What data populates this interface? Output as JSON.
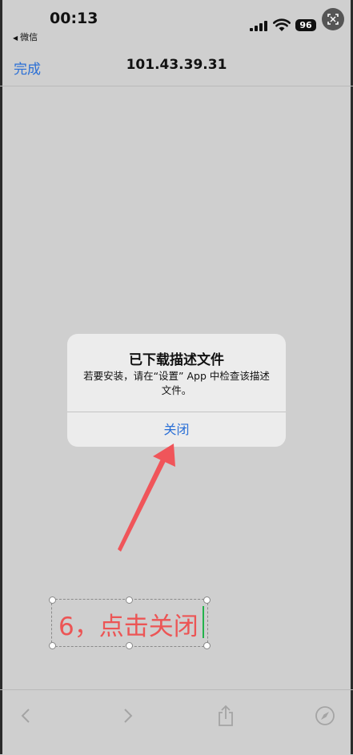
{
  "status_bar": {
    "time": "00:13",
    "back_app": "微信",
    "battery": "96"
  },
  "navbar": {
    "done_label": "完成",
    "title": "101.43.39.31"
  },
  "alert": {
    "title": "已下载描述文件",
    "message": "若要安装，请在“设置” App 中检查该描述文件。",
    "button_label": "关闭"
  },
  "annotation": {
    "text": "6，点击关闭",
    "color": "#ec5555",
    "arrow_color": "#f0555a"
  },
  "toolbar": {
    "icons": [
      "back-icon",
      "forward-icon",
      "share-icon",
      "compass-icon"
    ]
  },
  "colors": {
    "accent": "#2a6fd6",
    "background": "#cfcfcf"
  }
}
